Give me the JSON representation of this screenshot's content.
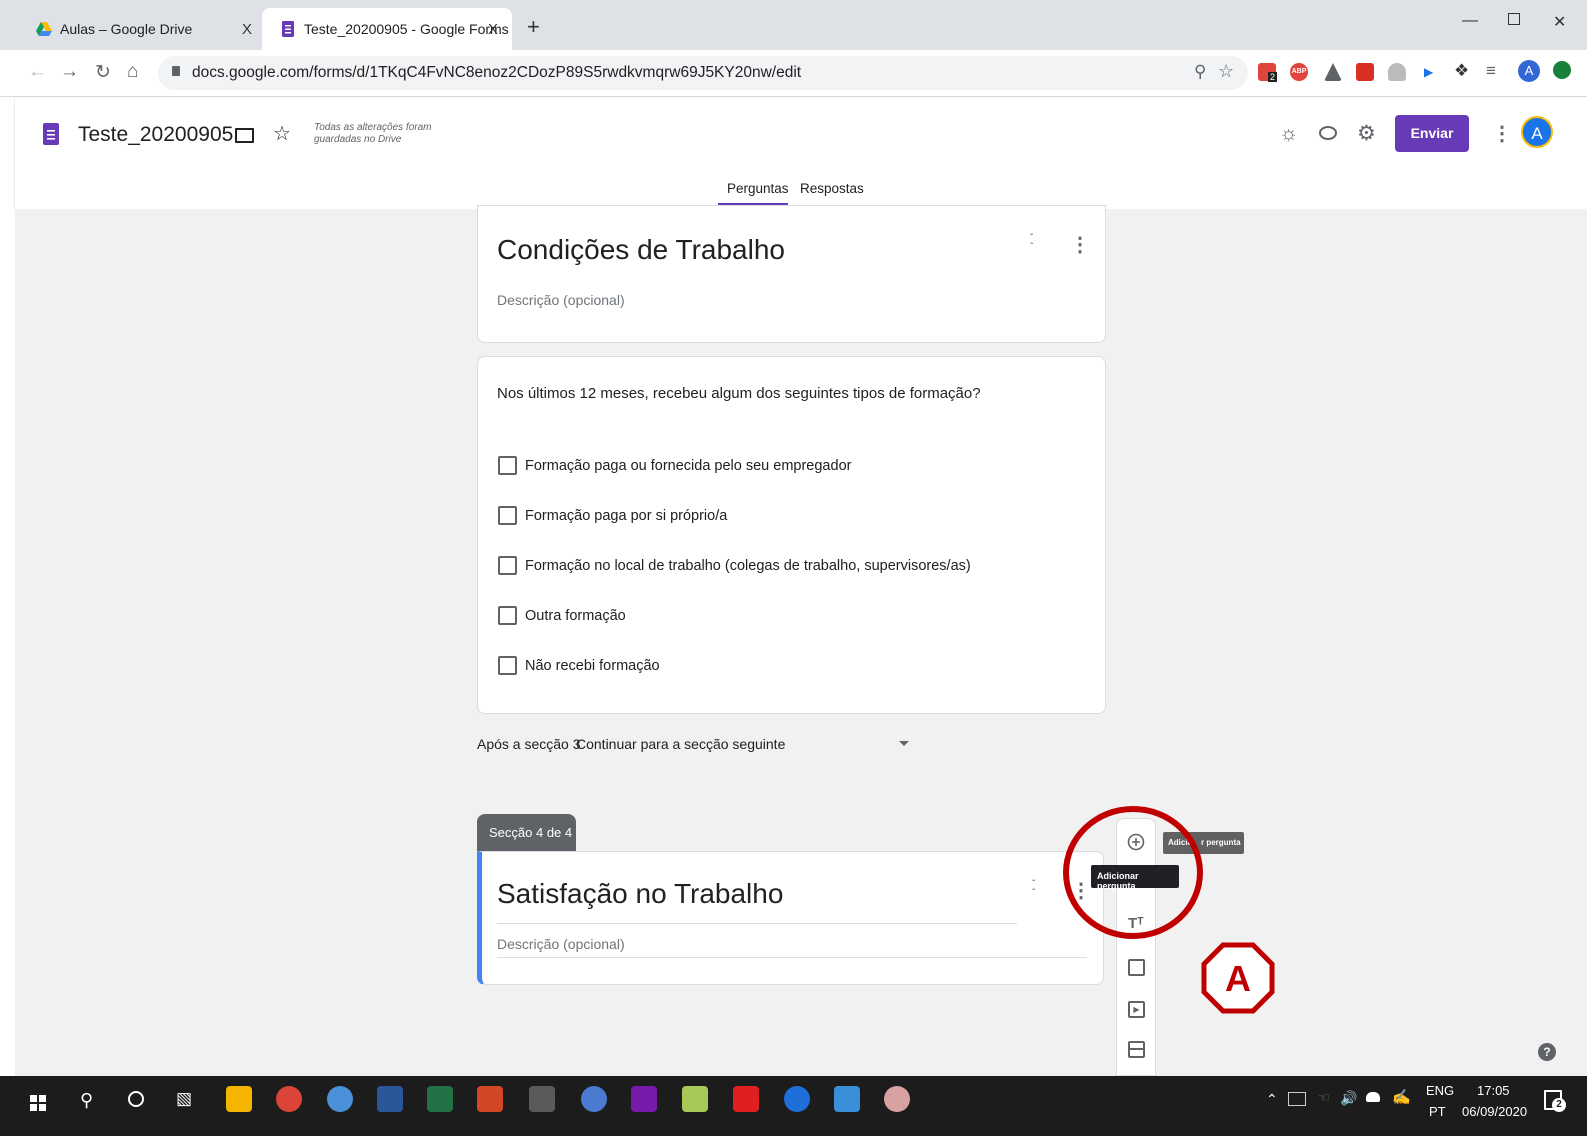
{
  "browser": {
    "tabs": [
      {
        "title": "Aulas – Google Drive",
        "close": "X"
      },
      {
        "title": "Teste_20200905 - Google Forms",
        "close": "X"
      }
    ],
    "new_tab": "+",
    "url": "docs.google.com/forms/d/1TKqC4FvNC8enoz2CDozP89S5rwdkvmqrw69J5KY20nw/edit",
    "profile_initial": "A",
    "ext_badge": "2",
    "ext_abp": "ABP"
  },
  "forms": {
    "title": "Teste_20200905",
    "save_status_line1": "Todas as alterações foram",
    "save_status_line2": "guardadas no Drive",
    "send_label": "Enviar",
    "avatar_initial": "A",
    "tabs": [
      "Perguntas",
      "Respostas"
    ],
    "accent": "#673ab7"
  },
  "section3": {
    "title": "Condições de Trabalho",
    "description_placeholder": "Descrição (opcional)",
    "question": "Nos últimos 12 meses, recebeu algum dos seguintes tipos de formação?",
    "options": [
      "Formação paga ou fornecida pelo seu empregador",
      "Formação paga por si próprio/a",
      "Formação no local de trabalho (colegas de trabalho, supervisores/as)",
      "Outra formação",
      "Não recebi formação"
    ],
    "after_label": "Após a secção 3",
    "after_value": "Continuar para a secção seguinte"
  },
  "section4": {
    "badge": "Secção 4 de 4",
    "title": "Satisfação no Trabalho",
    "description_placeholder": "Descrição (opcional)"
  },
  "side_toolbar": {
    "tooltip_main": "Adicionar pergunta",
    "tooltip_secondary_a": "Adicio",
    "tooltip_secondary_b": "r pergunta"
  },
  "annotation": {
    "letter": "A",
    "color": "#c00000"
  },
  "taskbar": {
    "lang_top": "ENG",
    "lang_bottom": "PT",
    "time": "17:05",
    "date": "06/09/2020",
    "notif_count": "2"
  }
}
